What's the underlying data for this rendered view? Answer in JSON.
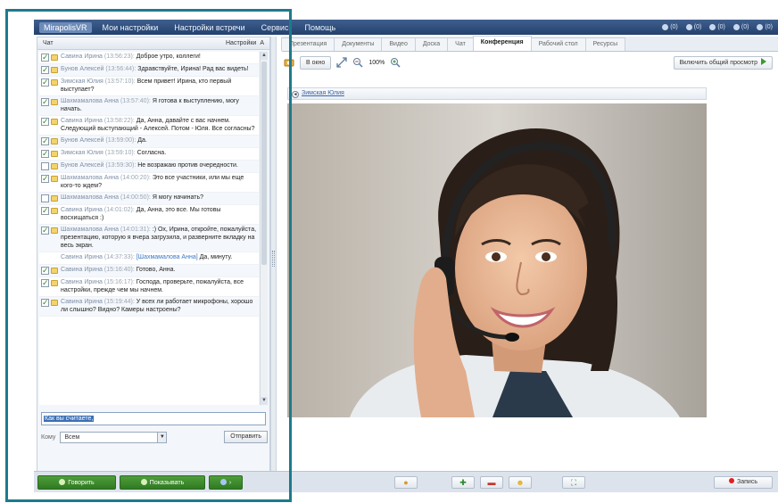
{
  "menubar": {
    "logo": "Mirapolis",
    "logo_suffix": "VR",
    "items": [
      "Мои настройки",
      "Настройки встречи",
      "Сервис",
      "Помощь"
    ],
    "counters": [
      "(0)",
      "(0)",
      "(0)",
      "(0)",
      "(0)"
    ]
  },
  "chat": {
    "header_label": "Чат",
    "settings_label": "Настройки",
    "settings_glyph": "А",
    "messages": [
      {
        "checked": true,
        "icon": true,
        "author": "Савина Ирина",
        "time": "(13:56:23)",
        "text": "Доброе утро, коллеги!"
      },
      {
        "checked": true,
        "icon": true,
        "author": "Бунов Алексей",
        "time": "(13:56:44)",
        "text": "Здравствуйте, Ирина! Рад вас видеть!"
      },
      {
        "checked": true,
        "icon": true,
        "author": "Зимская Юлия",
        "time": "(13:57:10)",
        "text": "Всем привет! Ирина, кто первый выступает?"
      },
      {
        "checked": true,
        "icon": true,
        "author": "Шахмамалова Анна",
        "time": "(13:57:40)",
        "text": "Я готова к выступлению, могу начать."
      },
      {
        "checked": true,
        "icon": true,
        "author": "Савина Ирина",
        "time": "(13:58:22)",
        "text": "Да, Анна, давайте с вас начнем. Следующий выступающий - Алексей. Потом - Юля. Все согласны?"
      },
      {
        "checked": true,
        "icon": true,
        "author": "Бунов Алексей",
        "time": "(13:59:00)",
        "text": "Да."
      },
      {
        "checked": true,
        "icon": true,
        "author": "Зимская Юлия",
        "time": "(13:59:10)",
        "text": "Согласна."
      },
      {
        "checked": false,
        "icon": true,
        "author": "Бунов Алексей",
        "time": "(13:59:30)",
        "text": "Не возражаю против очередности."
      },
      {
        "checked": true,
        "icon": true,
        "author": "Шахмамалова Анна",
        "time": "(14:00:20)",
        "text": "Это все участники, или мы еще кого-то ждем?"
      },
      {
        "checked": false,
        "icon": true,
        "author": "Шахмамалова Анна",
        "time": "(14:00:50)",
        "text": "Я могу начинать?"
      },
      {
        "checked": true,
        "icon": true,
        "author": "Савина Ирина",
        "time": "(14:01:02)",
        "text": "Да, Анна, это все. Мы готовы восхищаться :)"
      },
      {
        "checked": true,
        "icon": true,
        "author": "Шахмамалова Анна",
        "time": "(14:01:31)",
        "text": ":) Ох, Ирина, откройте, пожалуйста, презентацию, которую я вчера загрузила, и разверните вкладку на весь экран."
      },
      {
        "checked": null,
        "icon": false,
        "author": "Савина Ирина",
        "time": "(14:37:33)",
        "ref": "[Шахмамалова Анна]",
        "text": "Да, минуту."
      },
      {
        "checked": true,
        "icon": true,
        "author": "Савина Ирина",
        "time": "(15:16:40)",
        "text": "Готово, Анна."
      },
      {
        "checked": true,
        "icon": true,
        "author": "Савина Ирина",
        "time": "(15:16:17)",
        "text": "Господа, проверьте, пожалуйста, все настройки, прежде чем мы начнем."
      },
      {
        "checked": true,
        "icon": true,
        "author": "Савина Ирина",
        "time": "(15:19:44)",
        "text": "У всех ли работает микрофоны, хорошо ли слышно? Видно? Камеры настроены?"
      }
    ],
    "input_value": "Как вы считаете,",
    "to_label": "Кому",
    "to_value": "Всем",
    "send_label": "Отправить"
  },
  "bottombar": {
    "speak_label": "Говорить",
    "show_label": "Показывать",
    "extra_label": "›",
    "record_label": "Запись"
  },
  "tabs": [
    "Презентация",
    "Документы",
    "Видео",
    "Доска",
    "Чат",
    "Конференция",
    "Рабочий стол",
    "Ресурсы"
  ],
  "active_tab": "Конференция",
  "toolbar": {
    "window_label": "В окно",
    "zoom_label": "100%",
    "share_label": "Включить общий просмотр"
  },
  "video": {
    "participant_name": "Зимская Юлия"
  }
}
